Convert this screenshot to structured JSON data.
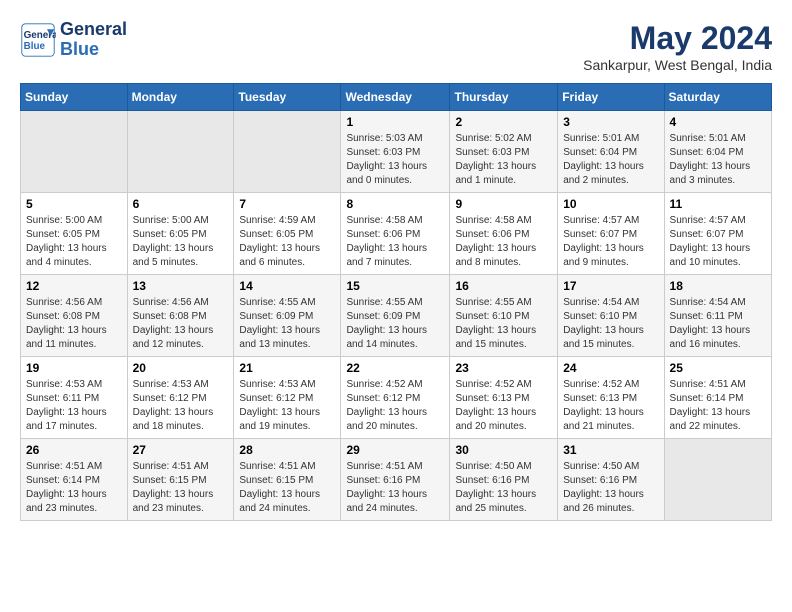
{
  "header": {
    "logo_line1": "General",
    "logo_line2": "Blue",
    "month": "May 2024",
    "location": "Sankarpur, West Bengal, India"
  },
  "weekdays": [
    "Sunday",
    "Monday",
    "Tuesday",
    "Wednesday",
    "Thursday",
    "Friday",
    "Saturday"
  ],
  "weeks": [
    [
      {
        "day": "",
        "empty": true
      },
      {
        "day": "",
        "empty": true
      },
      {
        "day": "",
        "empty": true
      },
      {
        "day": "1",
        "sunrise": "5:03 AM",
        "sunset": "6:03 PM",
        "daylight": "13 hours and 0 minutes."
      },
      {
        "day": "2",
        "sunrise": "5:02 AM",
        "sunset": "6:03 PM",
        "daylight": "13 hours and 1 minute."
      },
      {
        "day": "3",
        "sunrise": "5:01 AM",
        "sunset": "6:04 PM",
        "daylight": "13 hours and 2 minutes."
      },
      {
        "day": "4",
        "sunrise": "5:01 AM",
        "sunset": "6:04 PM",
        "daylight": "13 hours and 3 minutes."
      }
    ],
    [
      {
        "day": "5",
        "sunrise": "5:00 AM",
        "sunset": "6:05 PM",
        "daylight": "13 hours and 4 minutes."
      },
      {
        "day": "6",
        "sunrise": "5:00 AM",
        "sunset": "6:05 PM",
        "daylight": "13 hours and 5 minutes."
      },
      {
        "day": "7",
        "sunrise": "4:59 AM",
        "sunset": "6:05 PM",
        "daylight": "13 hours and 6 minutes."
      },
      {
        "day": "8",
        "sunrise": "4:58 AM",
        "sunset": "6:06 PM",
        "daylight": "13 hours and 7 minutes."
      },
      {
        "day": "9",
        "sunrise": "4:58 AM",
        "sunset": "6:06 PM",
        "daylight": "13 hours and 8 minutes."
      },
      {
        "day": "10",
        "sunrise": "4:57 AM",
        "sunset": "6:07 PM",
        "daylight": "13 hours and 9 minutes."
      },
      {
        "day": "11",
        "sunrise": "4:57 AM",
        "sunset": "6:07 PM",
        "daylight": "13 hours and 10 minutes."
      }
    ],
    [
      {
        "day": "12",
        "sunrise": "4:56 AM",
        "sunset": "6:08 PM",
        "daylight": "13 hours and 11 minutes."
      },
      {
        "day": "13",
        "sunrise": "4:56 AM",
        "sunset": "6:08 PM",
        "daylight": "13 hours and 12 minutes."
      },
      {
        "day": "14",
        "sunrise": "4:55 AM",
        "sunset": "6:09 PM",
        "daylight": "13 hours and 13 minutes."
      },
      {
        "day": "15",
        "sunrise": "4:55 AM",
        "sunset": "6:09 PM",
        "daylight": "13 hours and 14 minutes."
      },
      {
        "day": "16",
        "sunrise": "4:55 AM",
        "sunset": "6:10 PM",
        "daylight": "13 hours and 15 minutes."
      },
      {
        "day": "17",
        "sunrise": "4:54 AM",
        "sunset": "6:10 PM",
        "daylight": "13 hours and 15 minutes."
      },
      {
        "day": "18",
        "sunrise": "4:54 AM",
        "sunset": "6:11 PM",
        "daylight": "13 hours and 16 minutes."
      }
    ],
    [
      {
        "day": "19",
        "sunrise": "4:53 AM",
        "sunset": "6:11 PM",
        "daylight": "13 hours and 17 minutes."
      },
      {
        "day": "20",
        "sunrise": "4:53 AM",
        "sunset": "6:12 PM",
        "daylight": "13 hours and 18 minutes."
      },
      {
        "day": "21",
        "sunrise": "4:53 AM",
        "sunset": "6:12 PM",
        "daylight": "13 hours and 19 minutes."
      },
      {
        "day": "22",
        "sunrise": "4:52 AM",
        "sunset": "6:12 PM",
        "daylight": "13 hours and 20 minutes."
      },
      {
        "day": "23",
        "sunrise": "4:52 AM",
        "sunset": "6:13 PM",
        "daylight": "13 hours and 20 minutes."
      },
      {
        "day": "24",
        "sunrise": "4:52 AM",
        "sunset": "6:13 PM",
        "daylight": "13 hours and 21 minutes."
      },
      {
        "day": "25",
        "sunrise": "4:51 AM",
        "sunset": "6:14 PM",
        "daylight": "13 hours and 22 minutes."
      }
    ],
    [
      {
        "day": "26",
        "sunrise": "4:51 AM",
        "sunset": "6:14 PM",
        "daylight": "13 hours and 23 minutes."
      },
      {
        "day": "27",
        "sunrise": "4:51 AM",
        "sunset": "6:15 PM",
        "daylight": "13 hours and 23 minutes."
      },
      {
        "day": "28",
        "sunrise": "4:51 AM",
        "sunset": "6:15 PM",
        "daylight": "13 hours and 24 minutes."
      },
      {
        "day": "29",
        "sunrise": "4:51 AM",
        "sunset": "6:16 PM",
        "daylight": "13 hours and 24 minutes."
      },
      {
        "day": "30",
        "sunrise": "4:50 AM",
        "sunset": "6:16 PM",
        "daylight": "13 hours and 25 minutes."
      },
      {
        "day": "31",
        "sunrise": "4:50 AM",
        "sunset": "6:16 PM",
        "daylight": "13 hours and 26 minutes."
      },
      {
        "day": "",
        "empty": true
      }
    ]
  ]
}
